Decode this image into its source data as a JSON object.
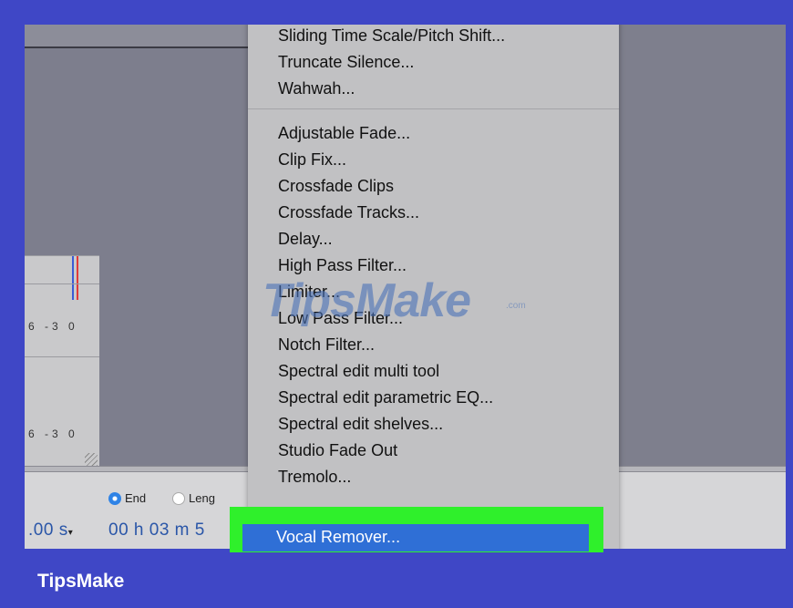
{
  "menu": {
    "group1": [
      "Sliding Time Scale/Pitch Shift...",
      "Truncate Silence...",
      "Wahwah..."
    ],
    "group2": [
      "Adjustable Fade...",
      "Clip Fix...",
      "Crossfade Clips",
      "Crossfade Tracks...",
      "Delay...",
      "High Pass Filter...",
      "Limiter...",
      "Low Pass Filter...",
      "Notch Filter...",
      "Spectral edit multi tool",
      "Spectral edit parametric EQ...",
      "Spectral edit shelves...",
      "Studio Fade Out",
      "Tremolo..."
    ],
    "highlighted_item": "Vocal Remover..."
  },
  "meters": {
    "scale_top": "6 -3 0",
    "scale_bottom": "6 -3 0"
  },
  "selection": {
    "end_label": "End",
    "length_label": "Leng",
    "start_time": ".00 s",
    "end_time": "00 h 03 m 5"
  },
  "watermark": {
    "text": "TipsMake",
    "suffix": ".com"
  },
  "brand": "TipsMake",
  "colors": {
    "frame": "#3f47c6",
    "highlight": "#2ff02b",
    "selection": "#2f6fd6"
  }
}
